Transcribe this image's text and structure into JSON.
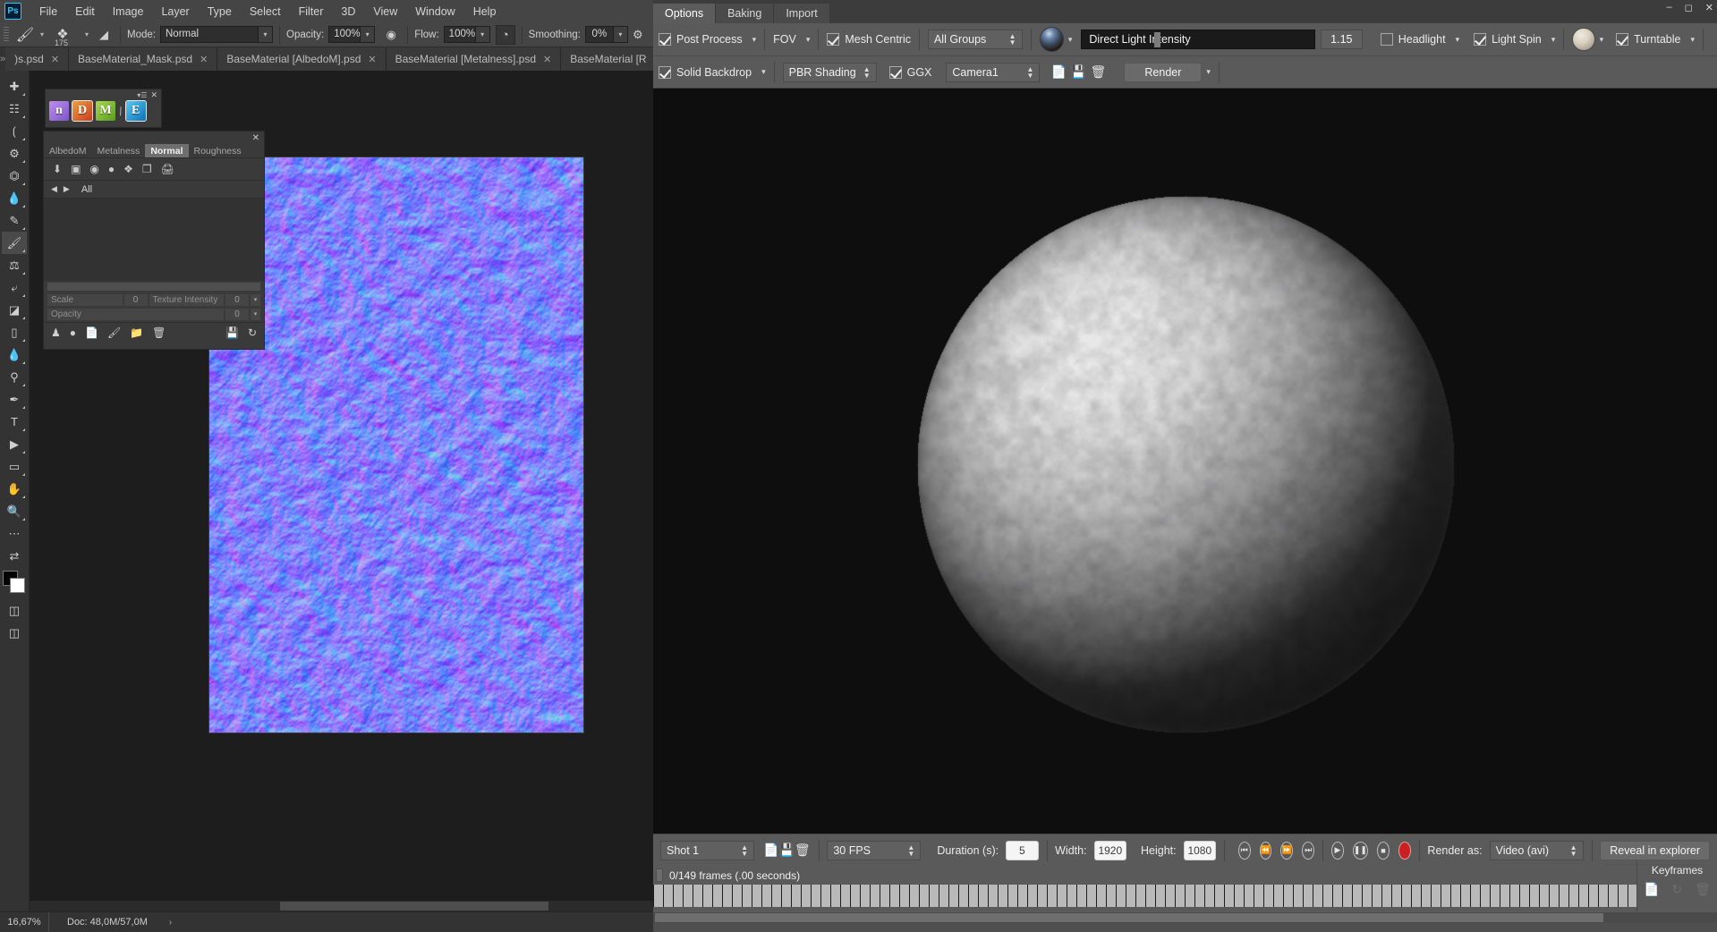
{
  "photoshop": {
    "app_logo": "Ps",
    "menu": [
      "File",
      "Edit",
      "Image",
      "Layer",
      "Type",
      "Select",
      "Filter",
      "3D",
      "View",
      "Window",
      "Help"
    ],
    "options_bar": {
      "brush_size": "175",
      "mode_label": "Mode:",
      "mode_value": "Normal",
      "opacity_label": "Opacity:",
      "opacity_value": "100%",
      "flow_label": "Flow:",
      "flow_value": "100%",
      "smoothing_label": "Smoothing:",
      "smoothing_value": "0%"
    },
    "tabs": [
      {
        "label": ")s.psd",
        "active": false
      },
      {
        "label": "BaseMaterial_Mask.psd",
        "active": false
      },
      {
        "label": "BaseMaterial [AlbedoM].psd",
        "active": false
      },
      {
        "label": "BaseMaterial [Metalness].psd",
        "active": false
      },
      {
        "label": "BaseMaterial [R",
        "active": false
      }
    ],
    "channel_icons": [
      {
        "glyph": "n",
        "color1": "#c08cf0",
        "color2": "#7a58c8",
        "boxed": false,
        "name": "normal-channel-icon"
      },
      {
        "glyph": "D",
        "color1": "#f0a03c",
        "color2": "#c83c20",
        "boxed": true,
        "name": "displacement-channel-icon"
      },
      {
        "glyph": "M",
        "color1": "#a8d84c",
        "color2": "#5a9c20",
        "boxed": false,
        "name": "metalness-channel-icon"
      },
      {
        "glyph": "E",
        "color1": "#58c8f0",
        "color2": "#1070b8",
        "boxed": true,
        "name": "emissive-channel-icon"
      }
    ],
    "material_panel": {
      "tabs": [
        "AlbedoM",
        "Metalness",
        "Normal",
        "Roughness"
      ],
      "active_tab": "Normal",
      "nav_label": "All",
      "rows": [
        {
          "name": "Scale",
          "value": "0",
          "second_name": "Texture Intensity",
          "second_value": "0"
        },
        {
          "name": "Opacity",
          "value": "0"
        }
      ]
    },
    "status": {
      "zoom": "16,67%",
      "doc": "Doc: 48,0M/57,0M",
      "arrow": "›"
    }
  },
  "marmoset": {
    "tabs": [
      {
        "label": "Options",
        "active": true
      },
      {
        "label": "Baking",
        "active": false
      },
      {
        "label": "Import",
        "active": false
      }
    ],
    "toolbar_row1": {
      "post_process": {
        "label": "Post Process",
        "checked": true
      },
      "fov": {
        "label": "FOV"
      },
      "mesh_centric": {
        "label": "Mesh Centric",
        "checked": true
      },
      "group_select": "All Groups",
      "light_field_value": "Direct Light Intensity",
      "light_intensity": "1.15",
      "headlight": {
        "label": "Headlight",
        "checked": false
      },
      "light_spin": {
        "label": "Light Spin",
        "checked": true
      },
      "turntable": {
        "label": "Turntable",
        "checked": true
      }
    },
    "toolbar_row2": {
      "solid_backdrop": {
        "label": "Solid Backdrop",
        "checked": true
      },
      "shading_select": "PBR Shading",
      "ggx": {
        "label": "GGX",
        "checked": true
      },
      "camera_select": "Camera1",
      "render_button": "Render"
    },
    "timeline_bar": {
      "shot_select": "Shot 1",
      "fps_select": "30 FPS",
      "duration_label": "Duration (s):",
      "duration_value": "5",
      "width_label": "Width:",
      "width_value": "1920",
      "height_label": "Height:",
      "height_value": "1080",
      "render_as_label": "Render as:",
      "render_as_value": "Video (avi)",
      "reveal_button": "Reveal in explorer"
    },
    "status_text": "0/149 frames (.00 seconds)",
    "keyframes": {
      "title": "Keyframes"
    }
  },
  "colors": {
    "ps_chrome": "#454545",
    "ps_panel": "#3a3a3a",
    "mt_chrome": "#5a5a5a",
    "accent_blue": "#31c5f0",
    "record_red": "#cc2020"
  }
}
